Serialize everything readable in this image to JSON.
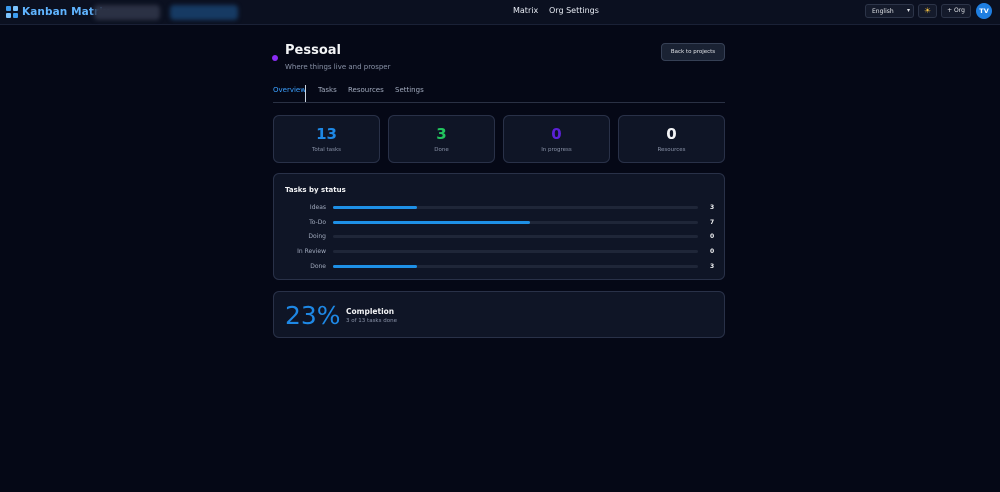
{
  "app": {
    "title": "Kanban Matrix"
  },
  "nav": {
    "matrix": "Matrix",
    "org_settings": "Org Settings"
  },
  "language": {
    "selected": "English"
  },
  "buttons": {
    "add_org": "+ Org",
    "back_to_projects": "Back to projects"
  },
  "user": {
    "initials": "TV"
  },
  "project": {
    "name": "Pessoal",
    "tagline": "Where things live and prosper",
    "color": "#8b2cf5"
  },
  "tabs": [
    {
      "label": "Overview",
      "active": true
    },
    {
      "label": "Tasks",
      "active": false
    },
    {
      "label": "Resources",
      "active": false
    },
    {
      "label": "Settings",
      "active": false
    }
  ],
  "stats": [
    {
      "value": "13",
      "label": "Total tasks",
      "color": "#1e88e5"
    },
    {
      "value": "3",
      "label": "Done",
      "color": "#22c55e"
    },
    {
      "value": "0",
      "label": "In progress",
      "color": "#5b21d6"
    },
    {
      "value": "0",
      "label": "Resources",
      "color": "#f3f4f6"
    }
  ],
  "status_panel": {
    "title": "Tasks by status",
    "total": 13,
    "rows": [
      {
        "label": "Ideas",
        "count": 3
      },
      {
        "label": "To-Do",
        "count": 7
      },
      {
        "label": "Doing",
        "count": 0
      },
      {
        "label": "In Review",
        "count": 0
      },
      {
        "label": "Done",
        "count": 3
      }
    ]
  },
  "completion": {
    "percent": "23%",
    "title": "Completion",
    "subtitle": "3 of 13 tasks done"
  },
  "colors": {
    "accent": "#1e88e5",
    "background": "#050816"
  }
}
